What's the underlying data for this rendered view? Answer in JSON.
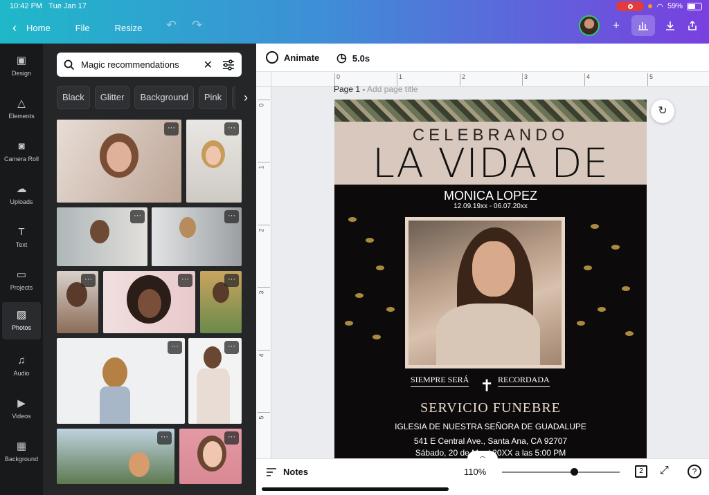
{
  "status": {
    "time": "10:42 PM",
    "date": "Tue Jan 17",
    "battery": "59%"
  },
  "topbar": {
    "home": "Home",
    "file": "File",
    "resize": "Resize"
  },
  "rail": [
    {
      "label": "Design"
    },
    {
      "label": "Elements"
    },
    {
      "label": "Camera Roll"
    },
    {
      "label": "Uploads"
    },
    {
      "label": "Text"
    },
    {
      "label": "Projects"
    },
    {
      "label": "Photos"
    },
    {
      "label": "Audio"
    },
    {
      "label": "Videos"
    },
    {
      "label": "Background"
    }
  ],
  "panel": {
    "search": "Magic recommendations",
    "chips": [
      "Black",
      "Glitter",
      "Background",
      "Pink",
      "Ma"
    ]
  },
  "canvas": {
    "animate": "Animate",
    "duration": "5.0s",
    "page_title": "Page 1 -",
    "page_title_placeholder": "Add page title",
    "ruler_h": [
      "0",
      "1",
      "2",
      "3",
      "4",
      "5"
    ],
    "ruler_v": [
      "0",
      "1",
      "2",
      "3",
      "4",
      "5"
    ]
  },
  "design": {
    "celebrando": "CELEBRANDO",
    "la_vida_de": "LA VIDA DE",
    "name": "MONICA LOPEZ",
    "dates": "12.09.19xx - 06.07.20xx",
    "siempre": "SIEMPRE SERÁ",
    "recordada": "RECORDADA",
    "servicio": "SERVICIO FUNEBRE",
    "iglesia": "IGLESIA DE NUESTRA SEÑORA DE GUADALUPE",
    "address": "541 E Central Ave., Santa Ana, CA 92707",
    "when": "Sábado, 20 de Ma      d 20XX a las 5:00 PM"
  },
  "bottom": {
    "notes": "Notes",
    "zoom": "110%",
    "pages": "2"
  }
}
